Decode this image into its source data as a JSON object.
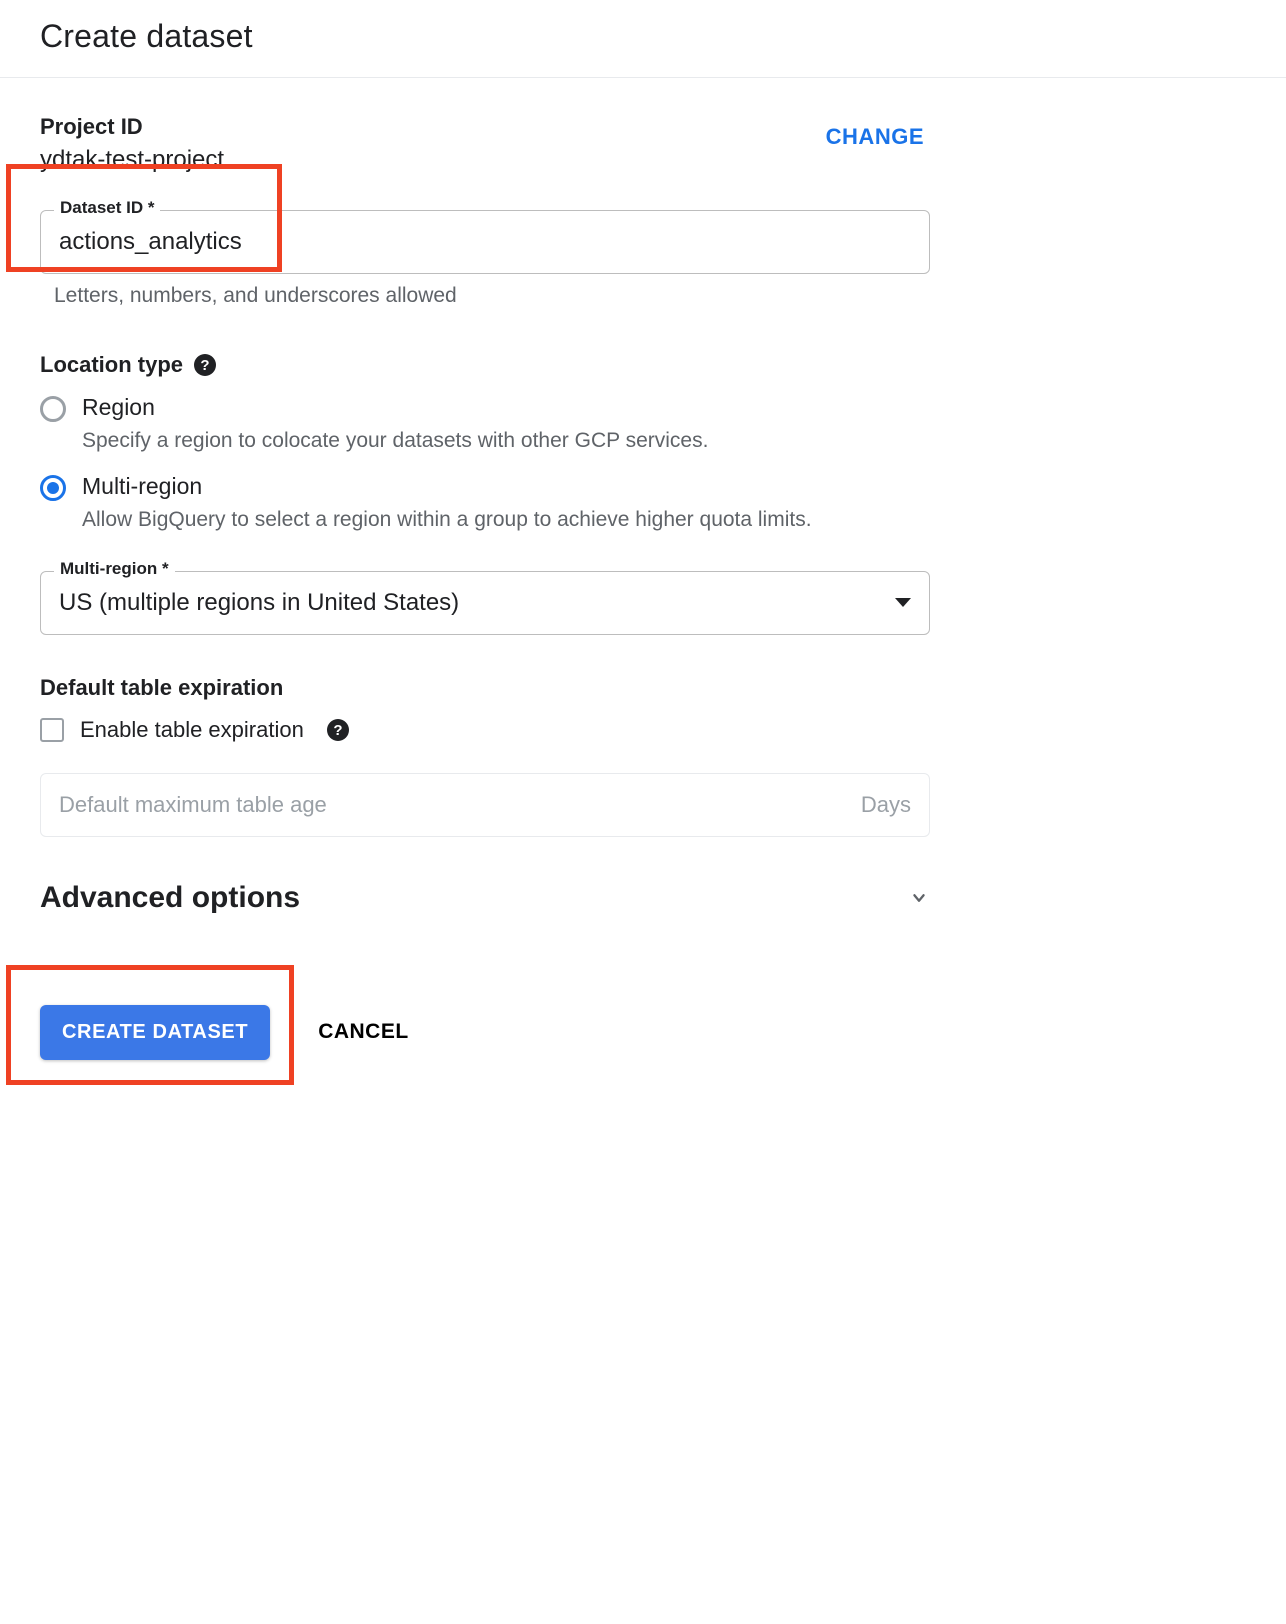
{
  "page_title": "Create dataset",
  "project_id": {
    "label": "Project ID",
    "value": "ydtak-test-project",
    "change_label": "CHANGE"
  },
  "dataset_id": {
    "label": "Dataset ID *",
    "value": "actions_analytics",
    "helper": "Letters, numbers, and underscores allowed"
  },
  "location": {
    "title": "Location type",
    "options": [
      {
        "label": "Region",
        "description": "Specify a region to colocate your datasets with other GCP services.",
        "selected": false
      },
      {
        "label": "Multi-region",
        "description": "Allow BigQuery to select a region within a group to achieve higher quota limits.",
        "selected": true
      }
    ],
    "multi_region_select": {
      "label": "Multi-region *",
      "value": "US (multiple regions in United States)"
    }
  },
  "expiration": {
    "title": "Default table expiration",
    "checkbox_label": "Enable table expiration",
    "checked": false,
    "max_age_placeholder": "Default maximum table age",
    "max_age_unit": "Days"
  },
  "advanced": {
    "title": "Advanced options"
  },
  "actions": {
    "create": "CREATE DATASET",
    "cancel": "CANCEL"
  }
}
